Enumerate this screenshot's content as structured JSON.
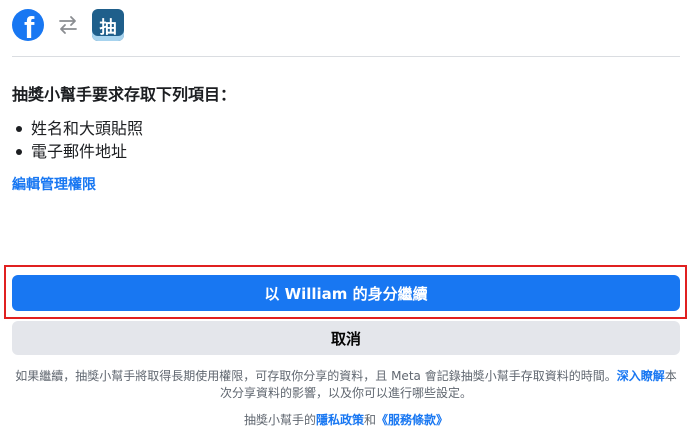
{
  "header": {
    "logo_letter": "f",
    "app_icon_glyph": "抽",
    "icons": [
      "facebook-icon",
      "swap-arrows-icon",
      "app-icon"
    ]
  },
  "permissions": {
    "heading": "抽獎小幫手要求存取下列項目：",
    "items": [
      "姓名和大頭貼照",
      "電子郵件地址"
    ],
    "edit_link": "編輯管理權限"
  },
  "actions": {
    "continue_label": "以 William 的身分繼續",
    "cancel_label": "取消"
  },
  "disclaimer": {
    "text_before": "如果繼續，抽獎小幫手將取得長期使用權限，可存取你分享的資料，且 Meta 會記錄抽獎小幫手存取資料的時間。",
    "learn_more": "深入瞭解",
    "text_after": "本次分享資料的影響，以及你可以進行哪些設定。"
  },
  "footer": {
    "prefix": "抽獎小幫手的",
    "privacy_link": "隱私政策",
    "joiner": "和",
    "terms_link": "《服務條款》"
  },
  "colors": {
    "brand_blue": "#1877f2",
    "cancel_gray": "#e4e6eb",
    "highlight_red": "#e02020",
    "app_icon_bg": "#1f5f8b"
  }
}
